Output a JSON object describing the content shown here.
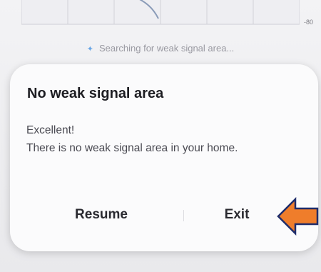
{
  "background": {
    "grid_scale_label": "-80",
    "status_text": "Searching for weak signal area..."
  },
  "dialog": {
    "title": "No weak signal area",
    "line1": "Excellent!",
    "line2": "There is no weak signal area in your home.",
    "resume_label": "Resume",
    "exit_label": "Exit"
  },
  "colors": {
    "arrow_fill": "#ef7d2b",
    "arrow_stroke": "#1f2d6b",
    "spinner": "#6aa6e6"
  },
  "icons": {
    "spinner": "loading-spinner-icon",
    "annotation": "left-arrow-annotation"
  }
}
